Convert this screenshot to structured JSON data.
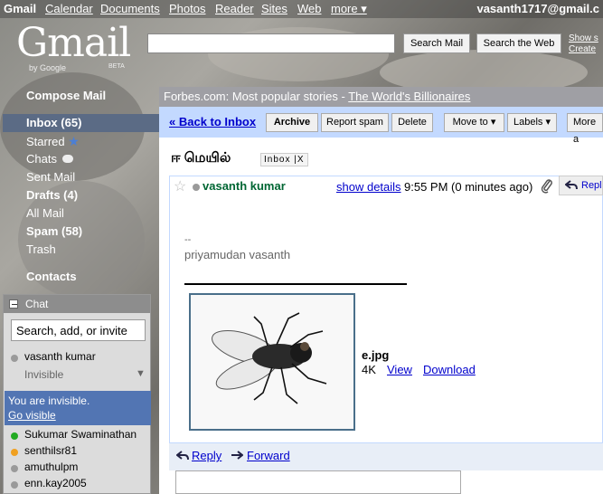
{
  "topbar": {
    "app_name": "Gmail",
    "links": [
      "Calendar",
      "Documents",
      "Photos",
      "Reader",
      "Sites",
      "Web",
      "more ▾"
    ],
    "account": "vasanth1717@gmail.c"
  },
  "logo": {
    "word": "Gmail",
    "by": "by Google",
    "beta": "BETA"
  },
  "search": {
    "value": "",
    "mail_button": "Search Mail",
    "web_button": "Search the Web",
    "options": [
      "Show s",
      "Create"
    ]
  },
  "nav": {
    "compose": "Compose Mail",
    "inbox": "Inbox (65)",
    "starred": "Starred",
    "chats": "Chats",
    "sent": "Sent Mail",
    "drafts": "Drafts (4)",
    "all": "All Mail",
    "spam": "Spam (58)",
    "trash": "Trash",
    "contacts": "Contacts"
  },
  "chat": {
    "title": "Chat",
    "search_value": "Search, add, or invite",
    "me_name": "vasanth kumar",
    "me_status": "Invisible",
    "invisible_msg": "You are invisible.",
    "go_visible": "Go visible",
    "contacts": [
      {
        "name": "Sukumar Swaminathan",
        "status_color": "#22aa22"
      },
      {
        "name": "senthilsr81",
        "status_color": "#f0a020"
      },
      {
        "name": "amuthulpm",
        "status_color": "#9a9a9a"
      },
      {
        "name": "enn.kay2005",
        "status_color": "#9a9a9a"
      }
    ]
  },
  "promo": {
    "prefix": "Forbes.com: Most popular stories - ",
    "link": "The World's Billionaires"
  },
  "toolbar": {
    "back": "« Back to Inbox",
    "archive": "Archive",
    "report_spam": "Report spam",
    "delete": "Delete",
    "move_to": "Move to ▾",
    "labels": "Labels ▾",
    "more": "More a"
  },
  "message": {
    "subject": "ஈ மெயில்",
    "label": "Inbox",
    "label_close": "X",
    "sender": "vasanth kumar",
    "show_details": "show details",
    "time": "9:55 PM (0 minutes ago)",
    "reply_top": "Repl",
    "sig_dash": "--",
    "sig_name": "priyamudan vasanth",
    "attachment": {
      "name": "e.jpg",
      "size": "4K",
      "view": "View",
      "download": "Download"
    },
    "reply": "Reply",
    "forward": "Forward"
  }
}
